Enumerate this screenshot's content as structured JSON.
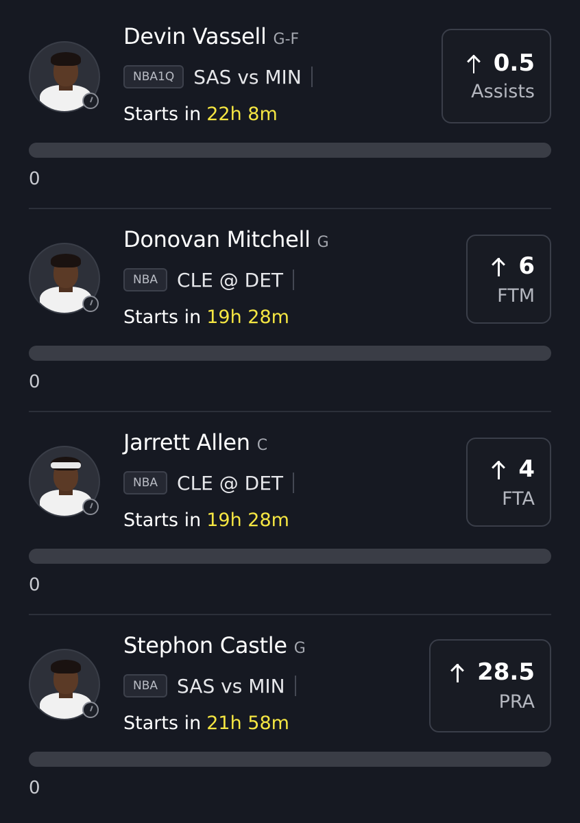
{
  "picks": [
    {
      "player_name": "Devin Vassell",
      "position": "G-F",
      "league": "NBA1Q",
      "matchup": "SAS vs MIN",
      "starts_label": "Starts in",
      "starts_time": "22h 8m",
      "line_value": "0.5",
      "stat": "Assists",
      "progress_value": "0",
      "progress_fraction": 0
    },
    {
      "player_name": "Donovan Mitchell",
      "position": "G",
      "league": "NBA",
      "matchup": "CLE @ DET",
      "starts_label": "Starts in",
      "starts_time": "19h 28m",
      "line_value": "6",
      "stat": "FTM",
      "progress_value": "0",
      "progress_fraction": 0
    },
    {
      "player_name": "Jarrett Allen",
      "position": "C",
      "league": "NBA",
      "matchup": "CLE @ DET",
      "starts_label": "Starts in",
      "starts_time": "19h 28m",
      "line_value": "4",
      "stat": "FTA",
      "progress_value": "0",
      "progress_fraction": 0
    },
    {
      "player_name": "Stephon Castle",
      "position": "G",
      "league": "NBA",
      "matchup": "SAS vs MIN",
      "starts_label": "Starts in",
      "starts_time": "21h 58m",
      "line_value": "28.5",
      "stat": "PRA",
      "progress_value": "0",
      "progress_fraction": 0
    }
  ],
  "colors": {
    "background": "#161922",
    "accent_time": "#f5e642",
    "progress_track": "#3a3d46"
  },
  "icons": {
    "direction": "arrow-up-icon",
    "pending": "clock-icon"
  }
}
